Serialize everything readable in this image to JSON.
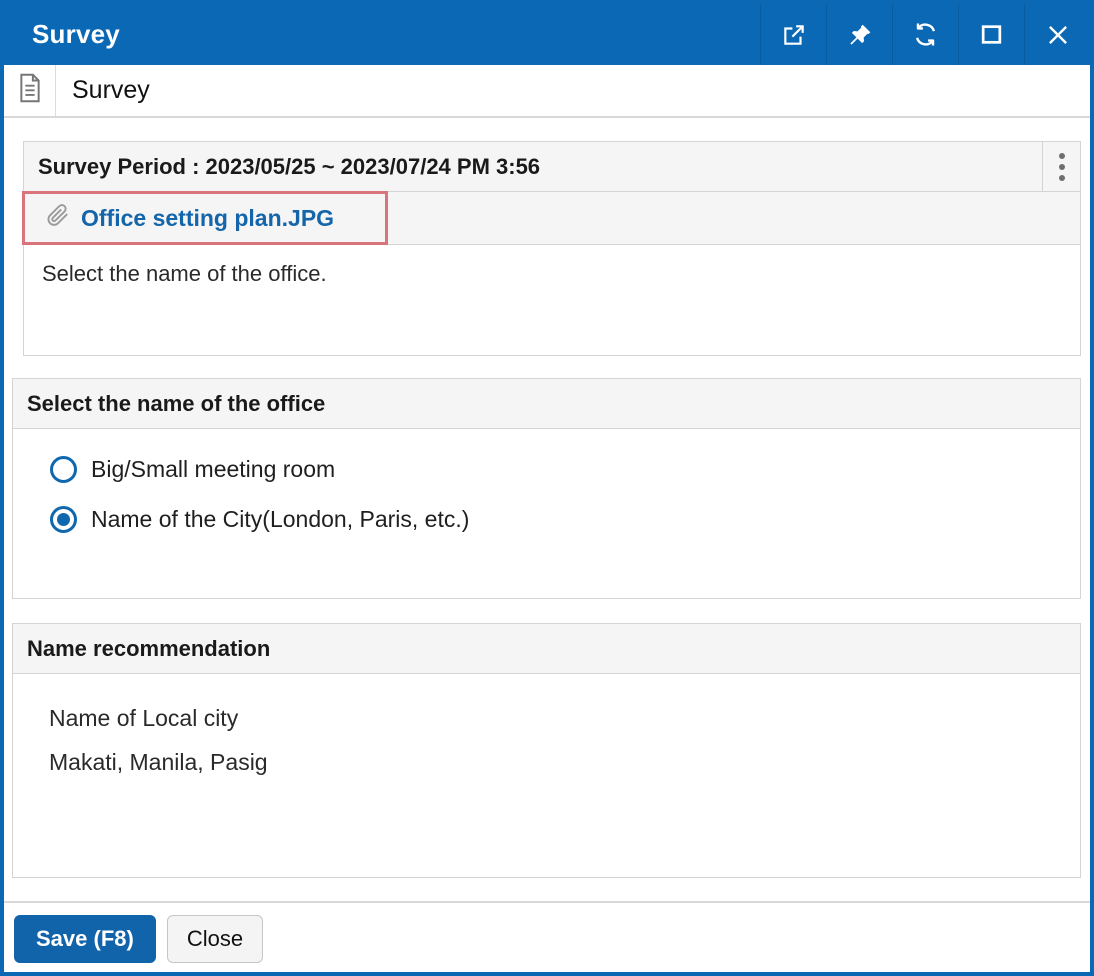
{
  "window": {
    "title": "Survey",
    "accent_color": "#0a68b4",
    "titlebar_icons": [
      "open-in-new-window",
      "pin",
      "refresh",
      "maximize",
      "close"
    ]
  },
  "breadcrumb": {
    "icon": "document-icon",
    "label": "Survey"
  },
  "survey_info": {
    "period_text": "Survey Period : 2023/05/25 ~ 2023/07/24 PM 3:56",
    "menu_icon": "kebab-menu",
    "attachment": {
      "icon": "paperclip-icon",
      "filename": "Office setting plan.JPG",
      "link_color": "#1465aa",
      "highlight_color": "#d9747c"
    },
    "description": "Select the name of the office."
  },
  "question": {
    "title": "Select the name of the office",
    "radio_color": "#0f67ad",
    "options": [
      {
        "label": "Big/Small meeting room",
        "selected": false
      },
      {
        "label": "Name of the City(London, Paris, etc.)",
        "selected": true
      }
    ]
  },
  "recommendation": {
    "title": "Name recommendation",
    "lines": [
      "Name of Local city",
      "Makati, Manila, Pasig"
    ]
  },
  "footer": {
    "save_label": "Save (F8)",
    "close_label": "Close",
    "save_color": "#1264aa"
  }
}
